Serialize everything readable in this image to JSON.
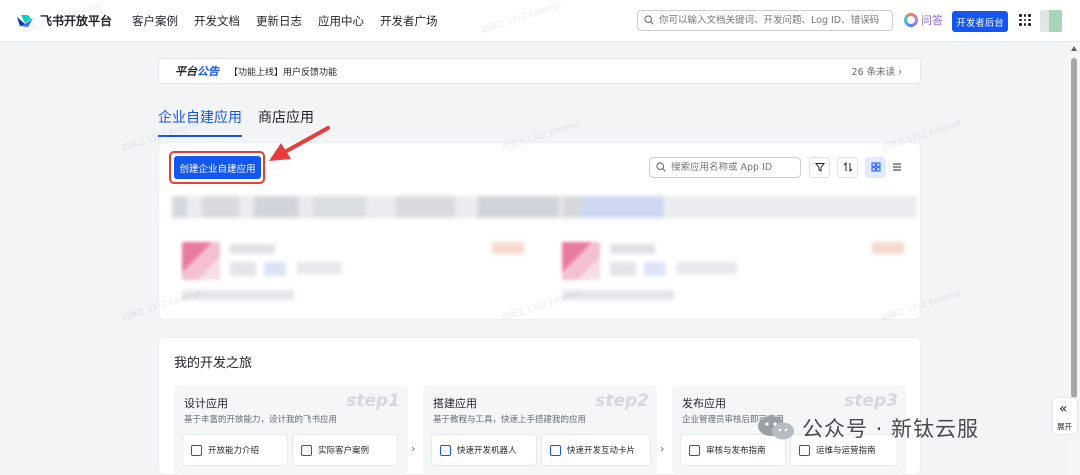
{
  "header": {
    "logo_text": "飞书开放平台",
    "nav": [
      "客户案例",
      "开发文档",
      "更新日志",
      "应用中心",
      "开发者广场"
    ],
    "search_placeholder": "你可以输入文档关键词、开发问题、Log ID、错误码",
    "qa_label": "问答",
    "dev_console": "开发者后台"
  },
  "notice": {
    "title_prefix": "平台",
    "title_highlight": "公告",
    "text": "【功能上线】用户反馈功能",
    "count": "26 条未读",
    "count_chevron": "›"
  },
  "tabs": [
    {
      "label": "企业自建应用",
      "active": true
    },
    {
      "label": "商店应用",
      "active": false
    }
  ],
  "apps_panel": {
    "create_button": "创建企业自建应用",
    "search_placeholder": "搜索应用名称或 App ID"
  },
  "journey": {
    "title": "我的开发之旅",
    "steps": [
      {
        "title": "设计应用",
        "desc": "基于丰富的开放能力，设计我的飞书应用",
        "tag": "step1",
        "chips": [
          "开放能力介绍",
          "实际客户案例"
        ]
      },
      {
        "title": "搭建应用",
        "desc": "基于教程与工具，快速上手搭建我的应用",
        "tag": "step2",
        "chips": [
          "快速开发机器人",
          "快速开发互动卡片"
        ]
      },
      {
        "title": "发布应用",
        "desc": "企业管理员审核后即可使用",
        "tag": "step3",
        "chips": [
          "审核与发布指南",
          "运维与运营指南"
        ]
      }
    ],
    "step_chevron": "›"
  },
  "overlay": {
    "wechat_text": "公众号 · 新钛云服",
    "expand_label": "展开",
    "expand_chevron": "«"
  },
  "watermark": "旧版之 1312 External",
  "colors": {
    "accent": "#1456f0",
    "highlight": "#e83b3b",
    "background": "#f3f4f6"
  }
}
